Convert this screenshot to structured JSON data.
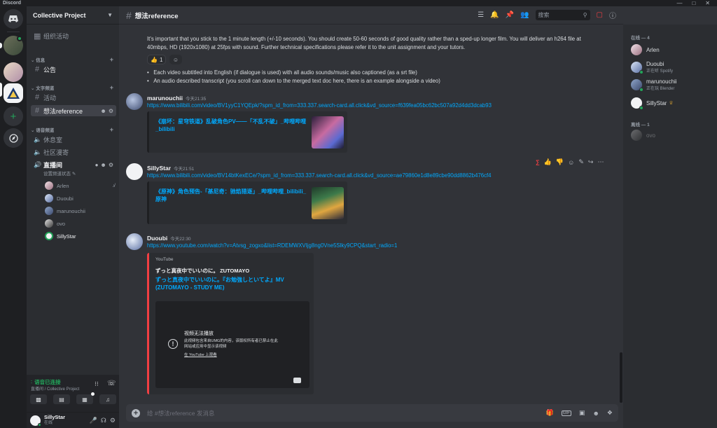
{
  "app": {
    "title": "Discord"
  },
  "server": {
    "name": "Collective Project"
  },
  "sidebar": {
    "top_item": "组织活动",
    "cat_info": "信息",
    "announce": "公告",
    "cat_text": "文字频道",
    "activity": "活动",
    "ideas": "想法reference",
    "cat_voice": "语音频道",
    "rest": "休息室",
    "community": "社区漫寄",
    "live": "直播间",
    "live_status": "设置频道状态",
    "voice_users": [
      "Arlen",
      "Duoubi",
      "marunouchii",
      "ovo",
      "SillyStar"
    ]
  },
  "voice_panel": {
    "status": "语音已连接",
    "location": "直播间 / Collective Project"
  },
  "user_panel": {
    "name": "SillyStar",
    "status": "在线"
  },
  "header": {
    "channel": "想法reference",
    "search_placeholder": "搜索"
  },
  "messages": {
    "intro_text": "It's important that you stick to the 1 minute length (+/-10 seconds). You should create 50-60 seconds of good quality rather than a sped-up longer film. You will deliver an h264 file at 40mbps, HD (1920x1080) at 25fps with sound. Further technical specifications please refer it to the unit assignment and your tutors.",
    "reaction_count": "1",
    "bullet1": "Each video subtitled into English (if dialogue is used) with all audio sounds/music also captioned (as a srt file)",
    "bullet2": "An audio described transcript (you scroll can down to the merged text doc here, there is an example alongside a video)",
    "m1": {
      "author": "marunouchii",
      "time": "今天21:35",
      "link": "https://www.bilibili.com/video/BV1yyC1YQEpk/?spm_id_from=333.337.search-card.all.click&vd_source=f639fea05bc62bc507a92d4dd3dcab93",
      "embed_title": "《崩坏：星穹铁道》乱破角色PV——「不乱不破」_哔哩哔哩_bilibili"
    },
    "m2": {
      "author": "SillyStar",
      "time": "今天21:51",
      "link": "https://www.bilibili.com/video/BV14btKexECe/?spm_id_from=333.337.search-card.all.click&vd_source=ae79860e1d8e89cbe90dd8862b476cf4",
      "embed_title": "《原神》角色预告-「基尼奇：驰焰猎逐」_哔哩哔哩_bilibili_原神"
    },
    "m3": {
      "author": "Duoubi",
      "time": "今天22:30",
      "link": "https://www.youtube.com/watch?v=Atvsg_zogxo&list=RDEMWXVIjg8ng0Vne5Slky9CPQ&start_radio=1",
      "provider": "YouTube",
      "channel": "ずっと真夜中でいいのに。 ZUTOMAYO",
      "embed_title": "ずっと真夜中でいいのに。『お勉強しといてよ』MV (ZUTOMAYO - STUDY ME)",
      "video_err_title": "视频无法播放",
      "video_err_body": "此视频包含来自UMG的内容，该版权所有者已禁止在此网站或应用中显示该视频",
      "video_err_link": "在 YouTube 上观看"
    }
  },
  "composer": {
    "placeholder": "给 #想法reference 发消息"
  },
  "members": {
    "online_header": "在线 — 4",
    "offline_header": "离线 — 1",
    "online": [
      {
        "name": "Arlen",
        "sub": ""
      },
      {
        "name": "Duoubi",
        "sub": "正在听 Spotify"
      },
      {
        "name": "marunouchii",
        "sub": "正在玩 Blender"
      },
      {
        "name": "SillyStar",
        "sub": ""
      }
    ],
    "offline": [
      {
        "name": "ovo"
      }
    ]
  },
  "colors": {
    "accent": "#5865f2",
    "green": "#23a55a",
    "link": "#00a8fc",
    "bg": "#313338"
  }
}
